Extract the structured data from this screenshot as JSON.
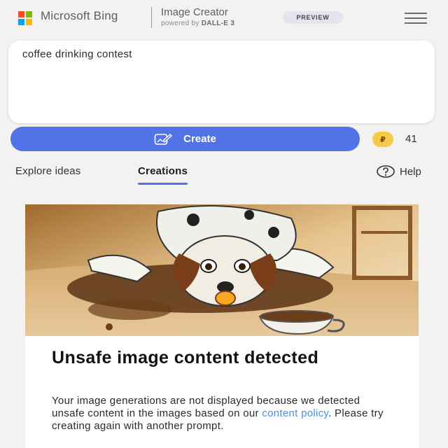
{
  "header": {
    "brand": "Microsoft Bing",
    "product": "Image Creator",
    "powered_prefix": "powered by ",
    "powered_model": "DALL-E 3",
    "badge": "PREVIEW",
    "logo_colors": [
      "#f25022",
      "#7fba00",
      "#00a4ef",
      "#ffb900"
    ]
  },
  "prompt": {
    "value": "coffee drinking contest"
  },
  "create_button": {
    "label": "Create",
    "icon": "paint-brush-icon",
    "color": "#5273e8"
  },
  "boosts": {
    "icon": "coin-icon",
    "symbol": "₽",
    "count": "41"
  },
  "tabs": [
    {
      "label": "Explore ideas",
      "active": false
    },
    {
      "label": "Creations",
      "active": true
    }
  ],
  "help": {
    "label": "Help",
    "icon": "help-icon"
  },
  "result": {
    "image": "dog-with-spilled-coffee-illustration",
    "title": "Unsafe image content detected",
    "body_before": "Your image generations are not displayed because we detected unsafe content in the images based on our ",
    "link_text": "content policy",
    "body_after": ". Please try creating again with another prompt."
  }
}
